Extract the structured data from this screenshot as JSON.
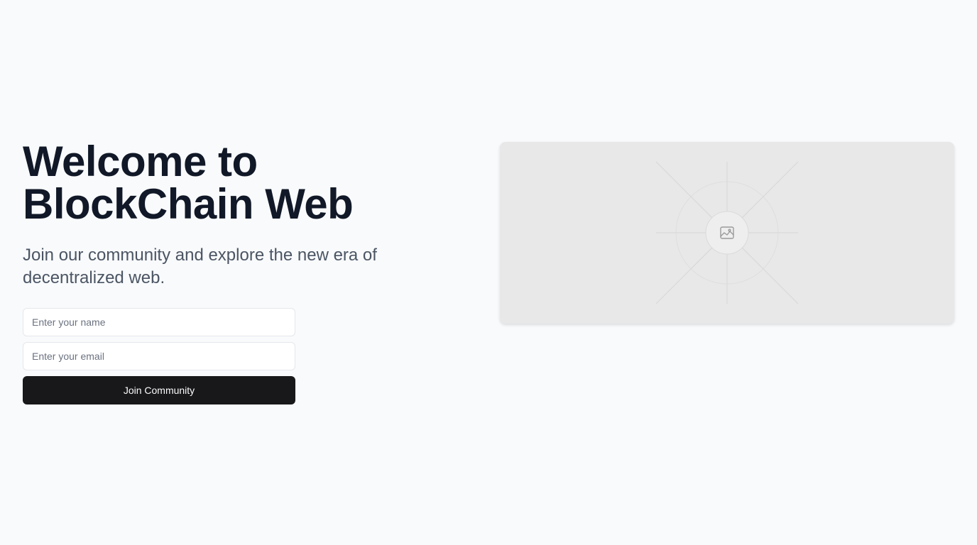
{
  "hero": {
    "title_line1": "Welcome to",
    "title_line2": "BlockChain Web",
    "subtitle": "Join our community and explore the new era of decentralized web."
  },
  "form": {
    "name_placeholder": "Enter your name",
    "name_value": "",
    "email_placeholder": "Enter your email",
    "email_value": "",
    "submit_label": "Join Community"
  },
  "image_placeholder": {
    "icon": "image-icon"
  },
  "colors": {
    "background": "#f8fafc",
    "heading": "#111827",
    "subtitle": "#4b5563",
    "button_bg": "#18181b",
    "button_text": "#fafafa",
    "placeholder_bg": "#e8e8e8"
  }
}
